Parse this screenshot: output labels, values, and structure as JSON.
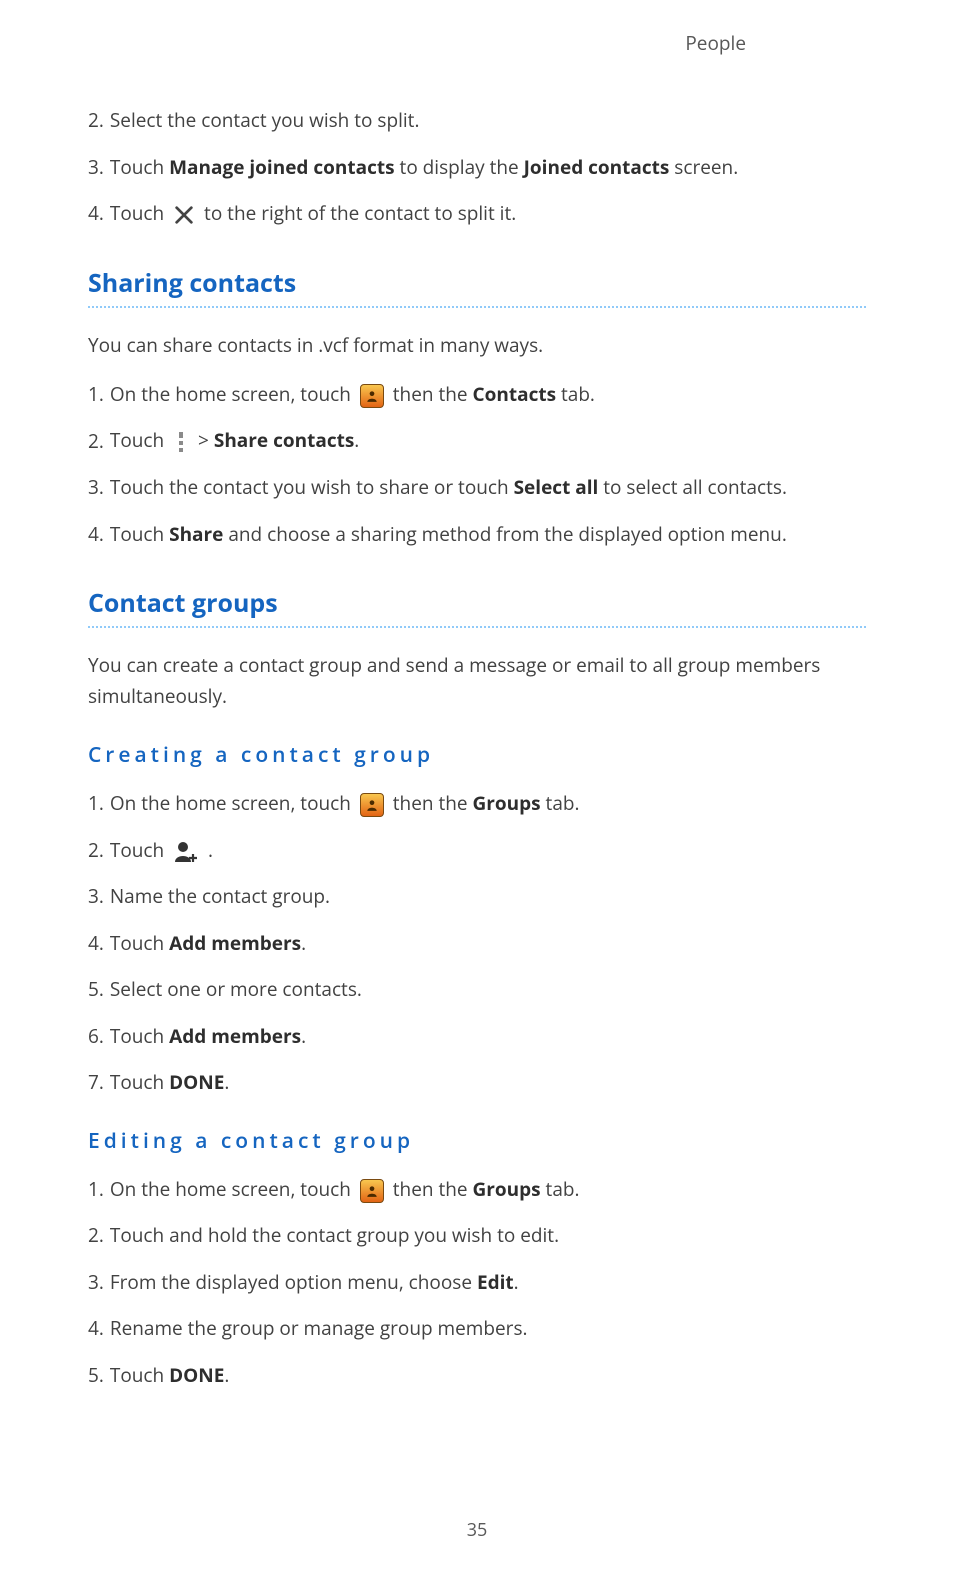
{
  "header": {
    "running": "People"
  },
  "intro_steps": [
    {
      "n": "2.",
      "parts": [
        {
          "t": "Select the contact you wish to split."
        }
      ]
    },
    {
      "n": "3.",
      "parts": [
        {
          "t": "Touch "
        },
        {
          "b": "Manage joined contacts"
        },
        {
          "t": " to display the "
        },
        {
          "b": "Joined contacts"
        },
        {
          "t": " screen."
        }
      ]
    },
    {
      "n": "4.",
      "parts": [
        {
          "t": "Touch "
        },
        {
          "icon": "x-icon"
        },
        {
          "t": " to the right of the contact to split it."
        }
      ]
    }
  ],
  "sections": {
    "sharing": {
      "title": "Sharing contacts",
      "intro": "You can share contacts in .vcf format in many ways.",
      "steps": [
        {
          "n": "1.",
          "parts": [
            {
              "t": "On the home screen, touch "
            },
            {
              "icon": "contacts-app-icon"
            },
            {
              "t": " then the "
            },
            {
              "b": "Contacts"
            },
            {
              "t": " tab."
            }
          ]
        },
        {
          "n": "2.",
          "parts": [
            {
              "t": "Touch "
            },
            {
              "icon": "overflow-icon"
            },
            {
              "t": " > "
            },
            {
              "b": "Share contacts"
            },
            {
              "t": "."
            }
          ]
        },
        {
          "n": "3.",
          "parts": [
            {
              "t": "Touch the contact you wish to share or touch "
            },
            {
              "b": "Select all"
            },
            {
              "t": " to select all contacts."
            }
          ]
        },
        {
          "n": "4.",
          "parts": [
            {
              "t": "Touch "
            },
            {
              "b": "Share"
            },
            {
              "t": " and choose a sharing method from the displayed option menu."
            }
          ]
        }
      ]
    },
    "groups": {
      "title": "Contact groups",
      "intro": "You can create a contact group and send a message or email to all group members simultaneously.",
      "creating": {
        "title": "Creating a contact group",
        "steps": [
          {
            "n": "1.",
            "parts": [
              {
                "t": "On the home screen, touch "
              },
              {
                "icon": "contacts-app-icon"
              },
              {
                "t": " then the "
              },
              {
                "b": "Groups"
              },
              {
                "t": " tab."
              }
            ]
          },
          {
            "n": "2.",
            "parts": [
              {
                "t": "Touch "
              },
              {
                "icon": "add-group-icon"
              },
              {
                "t": " ."
              }
            ]
          },
          {
            "n": "3.",
            "parts": [
              {
                "t": "Name the contact group."
              }
            ]
          },
          {
            "n": "4.",
            "parts": [
              {
                "t": "Touch "
              },
              {
                "b": "Add members"
              },
              {
                "t": "."
              }
            ]
          },
          {
            "n": "5.",
            "parts": [
              {
                "t": "Select one or more contacts."
              }
            ]
          },
          {
            "n": "6.",
            "parts": [
              {
                "t": "Touch "
              },
              {
                "b": "Add members"
              },
              {
                "t": "."
              }
            ]
          },
          {
            "n": "7.",
            "parts": [
              {
                "t": "Touch "
              },
              {
                "b": "DONE"
              },
              {
                "t": "."
              }
            ]
          }
        ]
      },
      "editing": {
        "title": "Editing a contact group",
        "steps": [
          {
            "n": "1.",
            "parts": [
              {
                "t": "On the home screen, touch "
              },
              {
                "icon": "contacts-app-icon"
              },
              {
                "t": " then the "
              },
              {
                "b": "Groups"
              },
              {
                "t": " tab."
              }
            ]
          },
          {
            "n": "2.",
            "parts": [
              {
                "t": "Touch and hold the contact group you wish to edit."
              }
            ]
          },
          {
            "n": "3.",
            "parts": [
              {
                "t": "From the displayed option menu, choose "
              },
              {
                "b": "Edit"
              },
              {
                "t": "."
              }
            ]
          },
          {
            "n": "4.",
            "parts": [
              {
                "t": "Rename the group or manage group members."
              }
            ]
          },
          {
            "n": "5.",
            "parts": [
              {
                "t": "Touch "
              },
              {
                "b": "DONE"
              },
              {
                "t": "."
              }
            ]
          }
        ]
      }
    }
  },
  "page_number": "35"
}
